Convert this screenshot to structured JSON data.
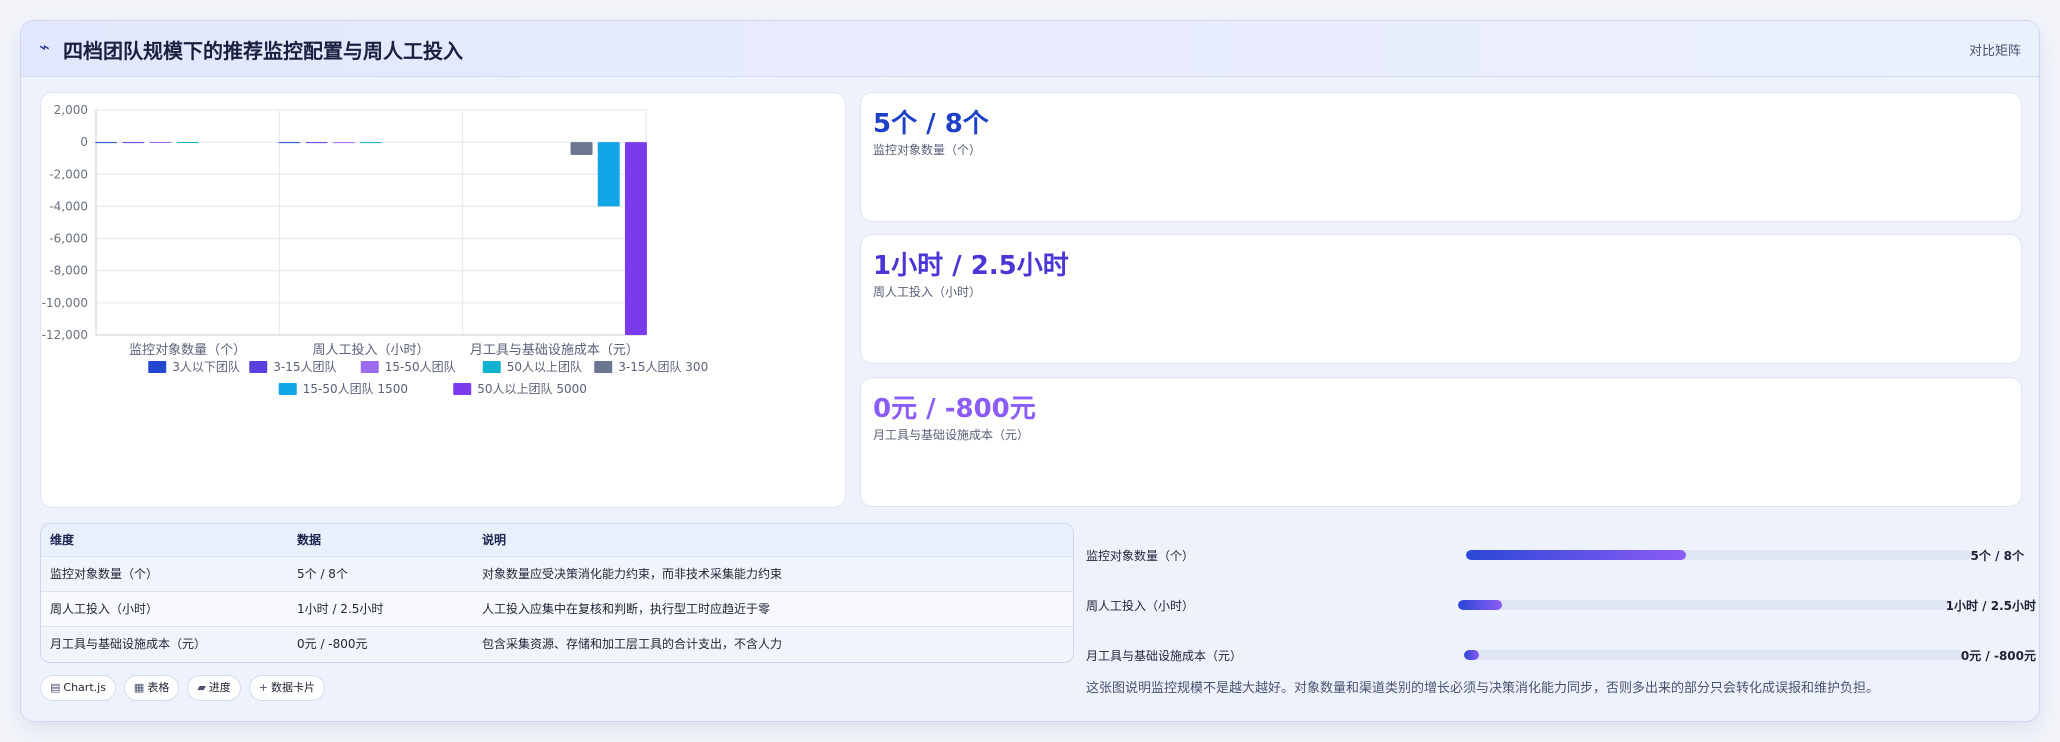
{
  "header": {
    "title": "四档团队规模下的推荐监控配置与周人工投入",
    "right_label": "对比矩阵"
  },
  "kpis": [
    {
      "value": "5个 / 8个",
      "label": "监控对象数量（个）",
      "color": "#1e40c8"
    },
    {
      "value": "1小时 / 2.5小时",
      "label": "周人工投入（小时）",
      "color": "#4a36d6"
    },
    {
      "value": "0元 / -800元",
      "label": "月工具与基础设施成本（元）",
      "color": "#8b5cf6"
    }
  ],
  "table": {
    "headers": [
      "维度",
      "数据",
      "说明"
    ],
    "rows": [
      [
        "监控对象数量（个）",
        "5个 / 8个",
        "对象数量应受决策消化能力约束，而非技术采集能力约束"
      ],
      [
        "周人工投入（小时）",
        "1小时 / 2.5小时",
        "人工投入应集中在复核和判断，执行型工时应趋近于零"
      ],
      [
        "月工具与基础设施成本（元）",
        "0元 / -800元",
        "包含采集资源、存储和加工层工具的合计支出，不含人力"
      ]
    ]
  },
  "progress": [
    {
      "label": "监控对象数量（个）",
      "value": "5个 / 8个",
      "fraction": 0.435
    },
    {
      "label": "周人工投入（小时）",
      "value": "1小时 / 2.5小时",
      "fraction": 0.09
    },
    {
      "label": "月工具与基础设施成本（元）",
      "value": "0元 / -800元",
      "fraction": 0.03
    }
  ],
  "note": "这张图说明监控规模不是越大越好。对象数量和渠道类别的增长必须与决策消化能力同步，否则多出来的部分只会转化成误报和维护负担。",
  "chips": [
    {
      "icon": "▤",
      "label": "Chart.js",
      "icon_name": "chart-icon"
    },
    {
      "icon": "▦",
      "label": "表格",
      "icon_name": "table-icon"
    },
    {
      "icon": "▰",
      "label": "进度",
      "icon_name": "progress-icon"
    },
    {
      "icon": "+",
      "label": "数据卡片",
      "icon_name": "plus-icon"
    }
  ],
  "chart_data": {
    "type": "bar",
    "categories": [
      "监控对象数量（个）",
      "周人工投入（小时）",
      "月工具与基础设施成本（元）"
    ],
    "ylim": [
      -12000,
      2000
    ],
    "yticks": [
      2000,
      0,
      -2000,
      -4000,
      -6000,
      -8000,
      -10000,
      -12000
    ],
    "yticklabels": [
      "2,000",
      "0",
      "-2,000",
      "-4,000",
      "-6,000",
      "-8,000",
      "-10,000",
      "-12,000"
    ],
    "grid": true,
    "legend_position": "bottom",
    "series": [
      {
        "name": "3人以下团队",
        "color": "#2447d1",
        "values": [
          3,
          0.5,
          null
        ]
      },
      {
        "name": "3-15人团队",
        "color": "#5b3fdc",
        "values": [
          5,
          1,
          null
        ]
      },
      {
        "name": "15-50人团队",
        "color": "#9b6cf0",
        "values": [
          8,
          2.5,
          null
        ]
      },
      {
        "name": "50人以上团队",
        "color": "#0fb3cf",
        "values": [
          12,
          5,
          null
        ]
      },
      {
        "name": "3-15人团队 300",
        "color": "#6b7690",
        "values": [
          null,
          null,
          -800
        ]
      },
      {
        "name": "15-50人团队 1500",
        "color": "#12a6e6",
        "values": [
          null,
          null,
          -4000
        ]
      },
      {
        "name": "50人以上团队 5000",
        "color": "#7c3aed",
        "values": [
          null,
          null,
          -12000
        ]
      }
    ]
  }
}
